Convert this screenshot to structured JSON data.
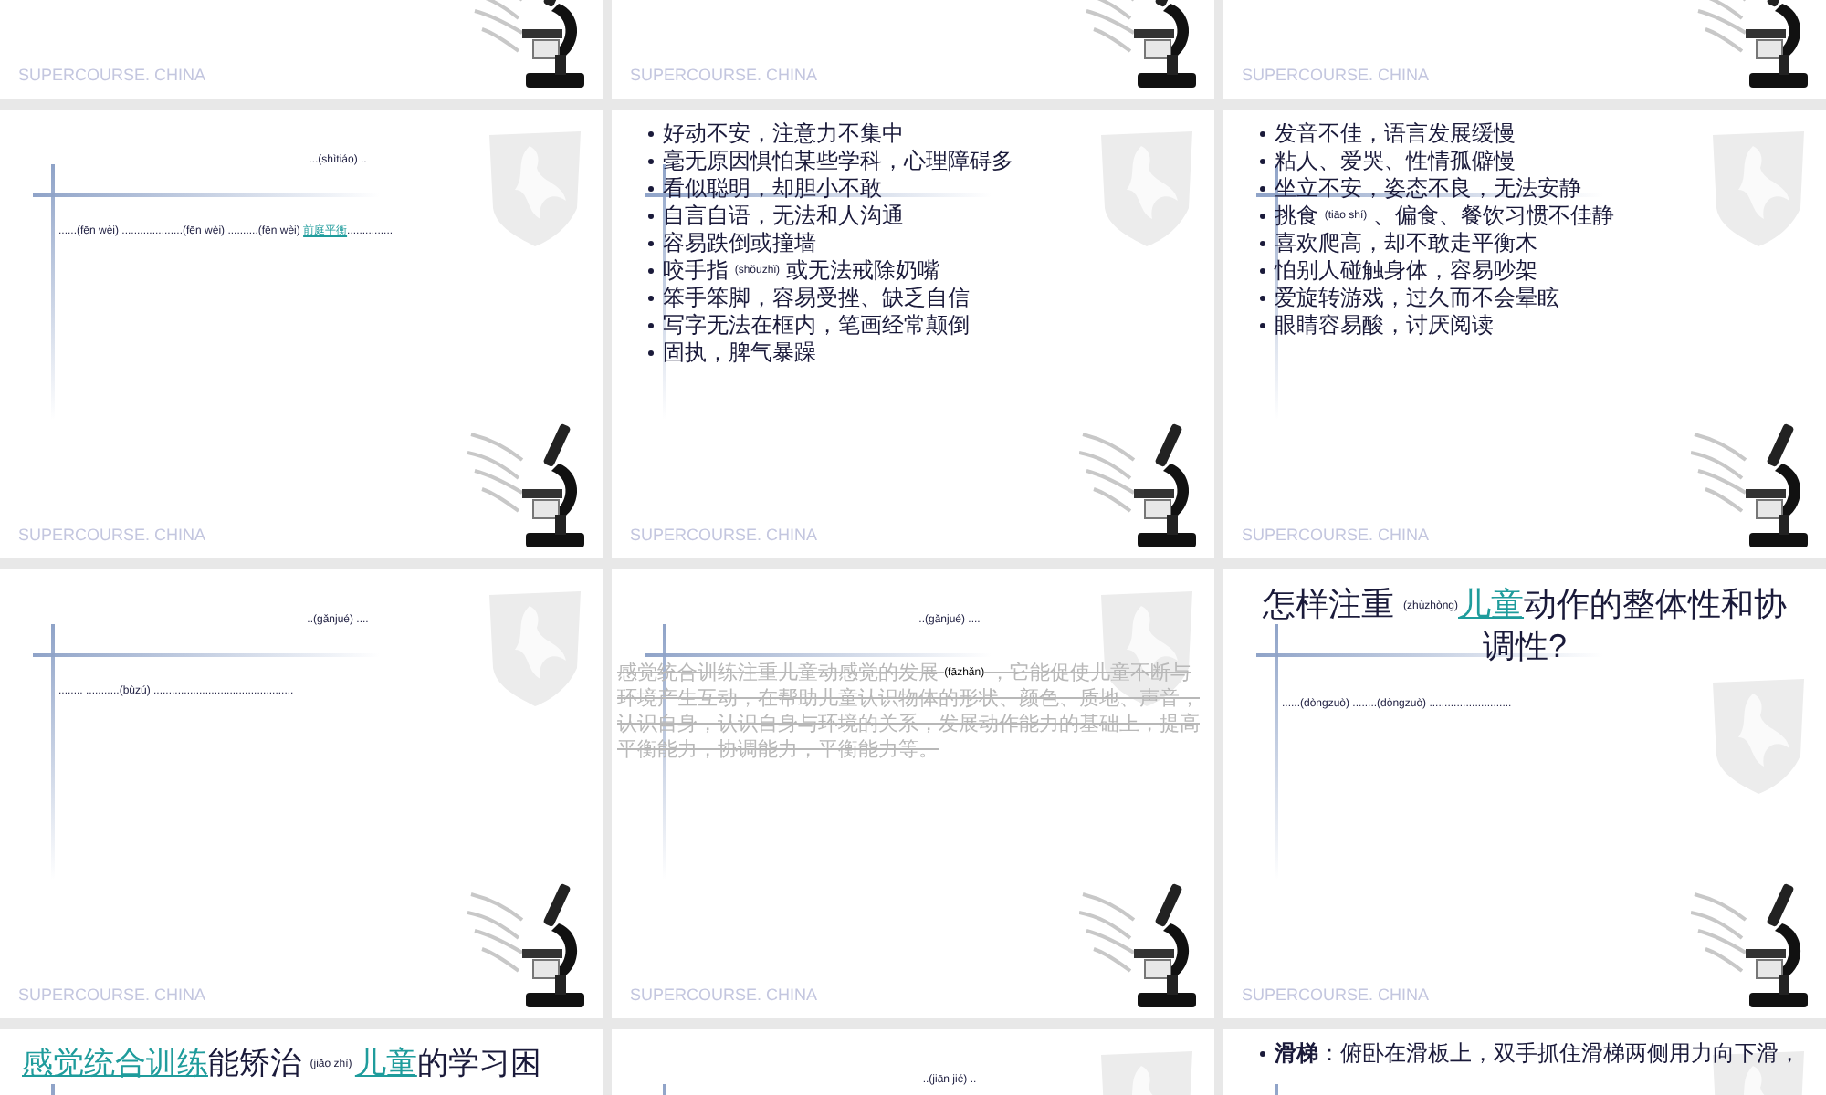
{
  "slides": [
    {
      "footer": "SUPERCOURSE. CHINA"
    },
    {
      "footer": "SUPERCOURSE. CHINA"
    },
    {
      "footer": "SUPERCOURSE. CHINA"
    },
    {
      "footer": "SUPERCOURSE. CHINA",
      "blocks": [
        {
          "kind": "subtitle",
          "runs": [
            {
              "kind": "text",
              "text": "...(shìtiáo) .."
            }
          ]
        },
        {
          "kind": "line",
          "runs": [
            {
              "kind": "text",
              "text": "......(fēn wèi) ....................(fēn wèi) ..........(fēn wèi) "
            },
            {
              "kind": "link",
              "text": "前庭平衡"
            },
            {
              "kind": "text",
              "text": "..............."
            }
          ]
        }
      ]
    },
    {
      "footer": "SUPERCOURSE. CHINA",
      "blocks": [
        {
          "kind": "bullets",
          "items": [
            [
              {
                "kind": "text",
                "text": "好动不安，注意力不集中"
              }
            ],
            [
              {
                "kind": "text",
                "text": "毫无原因惧怕某些学科，心理障碍多"
              }
            ],
            [
              {
                "kind": "text",
                "text": "看似聪明，却胆小不敢"
              }
            ],
            [
              {
                "kind": "text",
                "text": "自言自语，无法和人沟通"
              }
            ],
            [
              {
                "kind": "text",
                "text": "容易跌倒或撞墙"
              }
            ],
            [
              {
                "kind": "text",
                "text": "咬手指 "
              },
              {
                "kind": "pinyin",
                "text": "(shǒuzhǐ)"
              },
              {
                "kind": "text",
                "text": " 或无法戒除奶嘴"
              }
            ],
            [
              {
                "kind": "text",
                "text": "笨手笨脚，容易受挫、缺乏自信"
              }
            ],
            [
              {
                "kind": "text",
                "text": "写字无法在框内，笔画经常颠倒"
              }
            ],
            [
              {
                "kind": "text",
                "text": "固执，脾气暴躁"
              }
            ]
          ]
        }
      ]
    },
    {
      "footer": "SUPERCOURSE. CHINA",
      "blocks": [
        {
          "kind": "bullets",
          "items": [
            [
              {
                "kind": "text",
                "text": "发音不佳，语言发展缓慢"
              }
            ],
            [
              {
                "kind": "text",
                "text": "粘人、爱哭、性情孤僻慢"
              }
            ],
            [
              {
                "kind": "text",
                "text": "坐立不安，姿态不良，无法安静"
              }
            ],
            [
              {
                "kind": "text",
                "text": "挑食 "
              },
              {
                "kind": "pinyin",
                "text": "(tiāo shí)"
              },
              {
                "kind": "text",
                "text": " 、偏食、餐饮习惯不佳静"
              }
            ],
            [
              {
                "kind": "text",
                "text": "喜欢爬高，却不敢走平衡木"
              }
            ],
            [
              {
                "kind": "text",
                "text": "怕别人碰触身体，容易吵架"
              }
            ],
            [
              {
                "kind": "text",
                "text": "爱旋转游戏，过久而不会晕眩"
              }
            ],
            [
              {
                "kind": "text",
                "text": "眼睛容易酸，讨厌阅读"
              }
            ]
          ]
        }
      ]
    },
    {
      "footer": "SUPERCOURSE. CHINA",
      "blocks": [
        {
          "kind": "subtitle",
          "runs": [
            {
              "kind": "text",
              "text": "..(gǎnjué) ...."
            }
          ]
        },
        {
          "kind": "line",
          "runs": [
            {
              "kind": "text",
              "text": "........ ...........(bùzú) .............................................."
            }
          ]
        }
      ]
    },
    {
      "footer": "SUPERCOURSE. CHINA",
      "blocks": [
        {
          "kind": "subtitle",
          "runs": [
            {
              "kind": "text",
              "text": "..(gǎnjué) ...."
            }
          ]
        },
        {
          "kind": "paragraph",
          "runs": [
            {
              "kind": "struck",
              "text": "感觉统合训练注重儿童动感觉的发展 "
            },
            {
              "kind": "pinyin",
              "text": "(fāzhǎn)"
            },
            {
              "kind": "struck",
              "text": " ，它能促使儿童不断与环境产生互动，在帮助儿童认识物体的形状、颜色、质地、声音，认识自身，认识自身与环境的关系，发展动作能力的基础上，提高平衡能力，协调能力，平衡能力等。"
            }
          ]
        }
      ]
    },
    {
      "footer": "SUPERCOURSE. CHINA",
      "blocks": [
        {
          "kind": "centered_title",
          "runs": [
            {
              "kind": "text",
              "text": "怎样注重 "
            },
            {
              "kind": "pinyin",
              "text": "(zhùzhòng)"
            },
            {
              "kind": "link",
              "text": "儿童"
            },
            {
              "kind": "text",
              "text": "动作的整体性和协调性?"
            }
          ]
        },
        {
          "kind": "line",
          "runs": [
            {
              "kind": "text",
              "text": "......(dòngzuò) ........(dòngzuò) ..........................."
            }
          ]
        }
      ]
    },
    {
      "blocks": [
        {
          "kind": "title",
          "runs": [
            {
              "kind": "link",
              "text": "感觉统合训练"
            },
            {
              "kind": "text",
              "text": "能矫治 "
            },
            {
              "kind": "pinyin",
              "text": "(jiǎo zhì) "
            },
            {
              "kind": "link",
              "text": "儿童"
            },
            {
              "kind": "text",
              "text": "的学习困"
            }
          ]
        }
      ]
    },
    {
      "blocks": [
        {
          "kind": "subtitle",
          "runs": [
            {
              "kind": "text",
              "text": "..(jiān jié) .."
            }
          ]
        }
      ]
    },
    {
      "blocks": [
        {
          "kind": "bullets",
          "items": [
            [
              {
                "kind": "rich",
                "text": "**滑梯**：俯卧在滑板上，双手抓住滑梯两侧用力向下滑，"
              }
            ]
          ]
        }
      ]
    }
  ]
}
